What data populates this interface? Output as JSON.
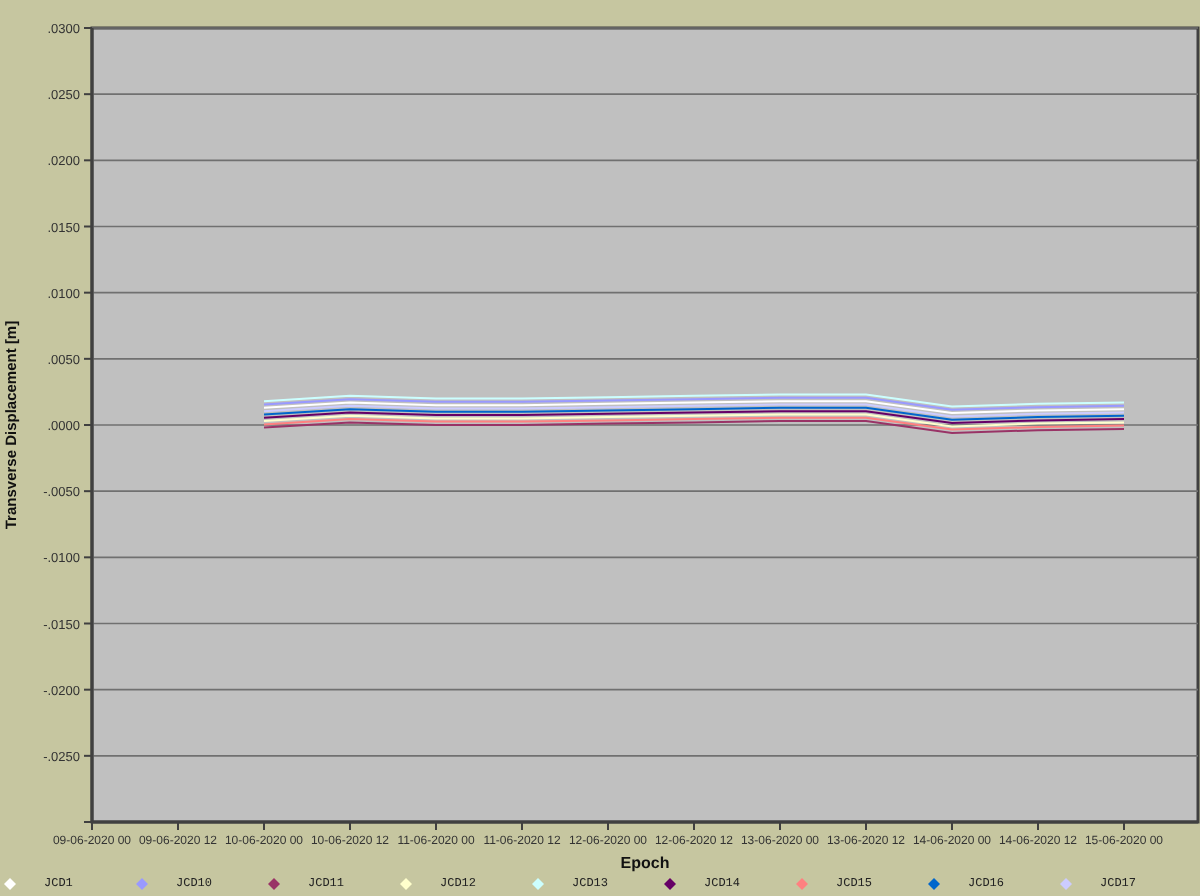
{
  "chart_data": {
    "type": "line",
    "xlabel": "Epoch",
    "ylabel": "Transverse Displacement [m]",
    "categories": [
      "09-06-2020 00",
      "09-06-2020 12",
      "10-06-2020 00",
      "10-06-2020 12",
      "11-06-2020 00",
      "11-06-2020 12",
      "12-06-2020 00",
      "12-06-2020 12",
      "13-06-2020 00",
      "13-06-2020 12",
      "14-06-2020 00",
      "14-06-2020 12",
      "15-06-2020 00"
    ],
    "ylim": [
      -0.03,
      0.03
    ],
    "grid": true,
    "yticks": [
      {
        "value": 0.03,
        "label": ".0300"
      },
      {
        "value": 0.025,
        "label": ".0250"
      },
      {
        "value": 0.02,
        "label": ".0200"
      },
      {
        "value": 0.015,
        "label": ".0150"
      },
      {
        "value": 0.01,
        "label": ".0100"
      },
      {
        "value": 0.005,
        "label": ".0050"
      },
      {
        "value": 0,
        "label": ".0000"
      },
      {
        "value": -0.005,
        "label": "-.0050"
      },
      {
        "value": -0.01,
        "label": "-.0100"
      },
      {
        "value": -0.015,
        "label": "-.0150"
      },
      {
        "value": -0.02,
        "label": "-.0200"
      },
      {
        "value": -0.025,
        "label": "-.0250"
      }
    ],
    "series": [
      {
        "name": "JCD1",
        "color": "#ffffff",
        "values": [
          null,
          null,
          0.0013,
          0.0017,
          0.0015,
          0.0015,
          0.0016,
          0.0017,
          0.0018,
          0.0018,
          0.0009,
          0.0011,
          0.0012
        ]
      },
      {
        "name": "JCD10",
        "color": "#9999ff",
        "values": [
          null,
          null,
          0.00155,
          0.00195,
          0.00175,
          0.00175,
          0.00185,
          0.00195,
          0.00205,
          0.00205,
          0.00115,
          0.00135,
          0.00145
        ]
      },
      {
        "name": "JCD11",
        "color": "#993366",
        "values": [
          null,
          null,
          -0.0002,
          0.0002,
          0.0,
          0.0,
          0.0001,
          0.0002,
          0.0003,
          0.0003,
          -0.0006,
          -0.0004,
          -0.0003
        ]
      },
      {
        "name": "JCD12",
        "color": "#ffffcc",
        "values": [
          null,
          null,
          0.0003,
          0.0007,
          0.0005,
          0.0005,
          0.0006,
          0.0007,
          0.0008,
          0.0008,
          -0.0001,
          0.0001,
          0.0002
        ]
      },
      {
        "name": "JCD13",
        "color": "#ccffff",
        "values": [
          null,
          null,
          0.0018,
          0.0022,
          0.002,
          0.002,
          0.0021,
          0.0022,
          0.0023,
          0.0023,
          0.0014,
          0.0016,
          0.0017
        ]
      },
      {
        "name": "JCD14",
        "color": "#660066",
        "values": [
          null,
          null,
          0.00055,
          0.00095,
          0.00075,
          0.00075,
          0.00085,
          0.00095,
          0.00105,
          0.00105,
          0.00015,
          0.00035,
          0.00045
        ]
      },
      {
        "name": "JCD15",
        "color": "#ff8080",
        "values": [
          null,
          null,
          5e-05,
          0.00045,
          0.00025,
          0.00025,
          0.00035,
          0.00045,
          0.00055,
          0.00055,
          -0.00035,
          -0.00015,
          -5e-05
        ]
      },
      {
        "name": "JCD16",
        "color": "#0066cc",
        "values": [
          null,
          null,
          0.0008,
          0.0012,
          0.001,
          0.001,
          0.0011,
          0.0012,
          0.0013,
          0.0013,
          0.0004,
          0.0006,
          0.0007
        ]
      },
      {
        "name": "JCD17",
        "color": "#ccccff",
        "values": [
          null,
          null,
          0.00105,
          0.00145,
          0.00125,
          0.00125,
          0.00135,
          0.00145,
          0.00155,
          0.00155,
          0.00065,
          0.00085,
          0.00095
        ]
      }
    ]
  }
}
